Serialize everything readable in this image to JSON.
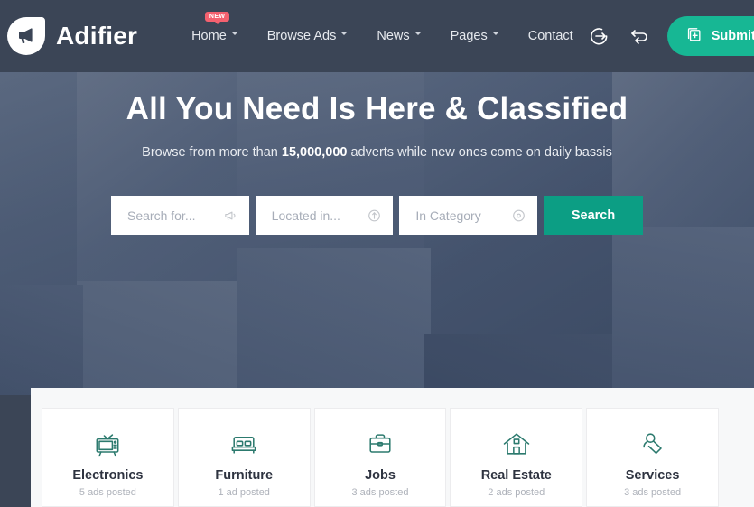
{
  "header": {
    "brand_name": "Adifier",
    "logo_icon": "megaphone-icon",
    "nav": [
      {
        "label": "Home",
        "has_caret": true,
        "badge": "NEW"
      },
      {
        "label": "Browse Ads",
        "has_caret": true,
        "badge": ""
      },
      {
        "label": "News",
        "has_caret": true,
        "badge": ""
      },
      {
        "label": "Pages",
        "has_caret": true,
        "badge": ""
      },
      {
        "label": "Contact",
        "has_caret": false,
        "badge": ""
      }
    ],
    "login_icon": "login-arrow-icon",
    "compare_icon": "compare-arrows-icon",
    "submit_label": "Submit Ad",
    "submit_icon": "add-document-icon",
    "bg_color": "#3b4556",
    "accent_color": "#17b794",
    "badge_color": "#f4616f"
  },
  "hero": {
    "title": "All You Need Is Here & Classified",
    "subtitle_before": "Browse from more than ",
    "subtitle_count": "15,000,000",
    "subtitle_after": " adverts while new ones come on daily bassis",
    "overlay_color": "#3a4862",
    "search": {
      "keyword_placeholder": "Search for...",
      "keyword_value": "",
      "keyword_icon": "megaphone-icon",
      "location_placeholder": "Located in...",
      "location_value": "",
      "location_icon": "location-pin-icon",
      "category_placeholder": "In Category",
      "category_value": "",
      "category_icon": "target-circle-icon",
      "button_label": "Search",
      "button_color": "#0c9e84"
    }
  },
  "categories": {
    "section_bg": "#f7f8f9",
    "icon_color": "#2c7a6e",
    "items": [
      {
        "name": "Electronics",
        "count": "5 ads posted",
        "icon": "tv-icon"
      },
      {
        "name": "Furniture",
        "count": "1 ad posted",
        "icon": "bed-icon"
      },
      {
        "name": "Jobs",
        "count": "3 ads posted",
        "icon": "briefcase-icon"
      },
      {
        "name": "Real Estate",
        "count": "2 ads posted",
        "icon": "house-icon"
      },
      {
        "name": "Services",
        "count": "3 ads posted",
        "icon": "person-handshake-icon"
      }
    ]
  }
}
